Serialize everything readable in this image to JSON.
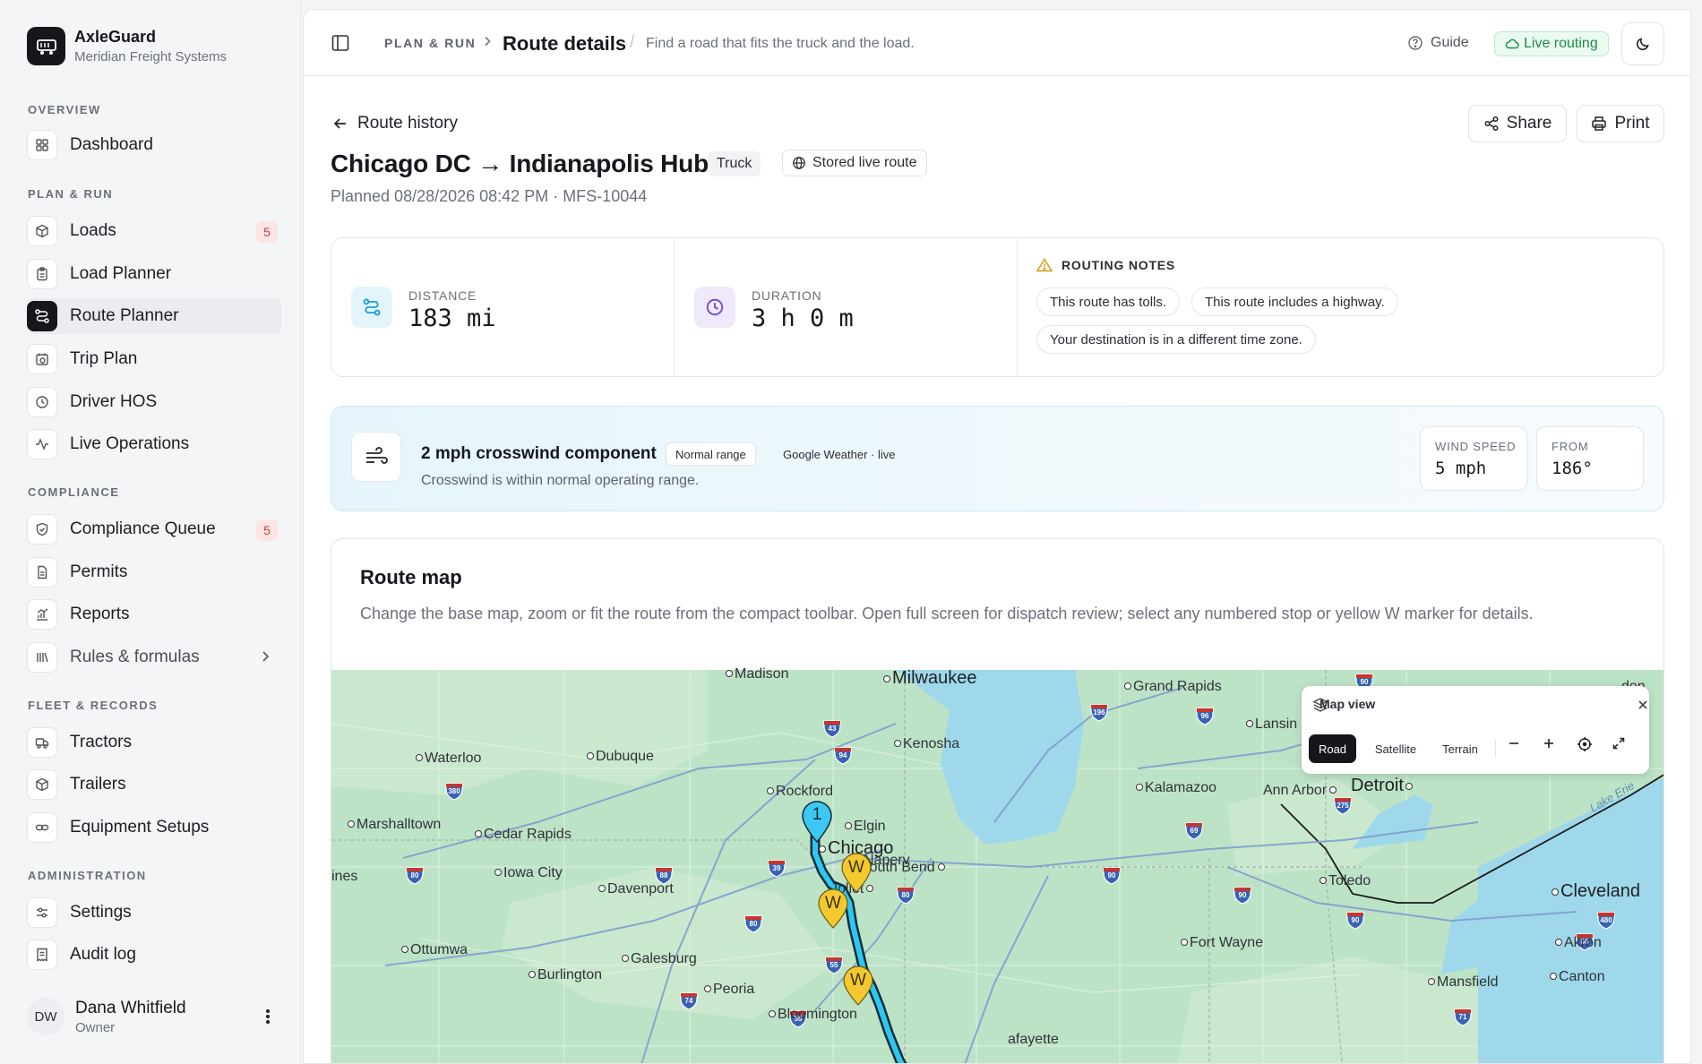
{
  "brand": {
    "name": "AxleGuard",
    "org": "Meridian Freight Systems"
  },
  "nav": {
    "overview_label": "OVERVIEW",
    "plan_label": "PLAN & RUN",
    "compliance_label": "COMPLIANCE",
    "fleet_label": "FLEET & RECORDS",
    "admin_label": "ADMINISTRATION",
    "items": {
      "dashboard": "Dashboard",
      "loads": "Loads",
      "loads_badge": "5",
      "load_planner": "Load Planner",
      "route_planner": "Route Planner",
      "trip_plan": "Trip Plan",
      "driver_hos": "Driver HOS",
      "live_ops": "Live Operations",
      "compliance_queue": "Compliance Queue",
      "compliance_badge": "5",
      "permits": "Permits",
      "reports": "Reports",
      "rules": "Rules & formulas",
      "tractors": "Tractors",
      "trailers": "Trailers",
      "equipment": "Equipment Setups",
      "settings": "Settings",
      "audit": "Audit log"
    }
  },
  "user": {
    "initials": "DW",
    "name": "Dana Whitfield",
    "role": "Owner"
  },
  "topbar": {
    "section": "PLAN & RUN",
    "title": "Route details",
    "description": "Find a road that fits the truck and the load.",
    "guide": "Guide",
    "live": "Live routing"
  },
  "route": {
    "back": "Route history",
    "share": "Share",
    "print": "Print",
    "title": "Chicago DC → Indianapolis Hub",
    "mode_tag": "Truck",
    "stored_tag": "Stored live route",
    "planned": "Planned 08/28/2026 08:42 PM · MFS-10044"
  },
  "stats": {
    "distance_label": "DISTANCE",
    "distance_value": "183 mi",
    "duration_label": "DURATION",
    "duration_value": "3 h 0 m",
    "notes_label": "ROUTING NOTES",
    "notes": [
      "This route has tolls.",
      "This route includes a highway.",
      "Your destination is in a different time zone."
    ]
  },
  "wind": {
    "title": "2 mph crosswind component",
    "range": "Normal range",
    "source": "Google Weather · live",
    "subtitle": "Crosswind is within normal operating range.",
    "speed_label": "WIND SPEED",
    "speed_value": "5 mph",
    "from_label": "FROM",
    "from_value": "186°"
  },
  "map": {
    "title": "Route map",
    "description": "Change the base map, zoom or fit the route from the compact toolbar. Open full screen for dispatch review; select any numbered stop or yellow W marker for details.",
    "view_title": "Map view",
    "road": "Road",
    "satellite": "Satellite",
    "terrain": "Terrain",
    "stop_number": "1",
    "waypoint_label": "W",
    "lake_label": "Lake Erie",
    "cities": {
      "madison": "Madison",
      "milwaukee": "Milwaukee",
      "grand_rapids": "Grand Rapids",
      "lansing": "Lansin",
      "kenosha": "Kenosha",
      "waterloo": "Waterloo",
      "dubuque": "Dubuque",
      "rockford": "Rockford",
      "kalamazoo": "Kalamazoo",
      "ann_arbor": "Ann Arbor",
      "detroit": "Detroit",
      "marshalltown": "Marshalltown",
      "cedar_rapids": "Cedar Rapids",
      "elgin": "Elgin",
      "chicago": "Chicago",
      "naperville": "Naperv",
      "south_bend": "South Bend",
      "toledo": "Toledo",
      "iowa_city": "Iowa City",
      "davenport": "Davenport",
      "joliet": "Joliet",
      "cleveland": "Cleveland",
      "ines": "ines",
      "fort_wayne": "Fort Wayne",
      "akron": "Akron",
      "ottumwa": "Ottumwa",
      "galesburg": "Galesburg",
      "burlington": "Burlington",
      "peoria": "Peoria",
      "mansfield": "Mansfield",
      "canton": "Canton",
      "bloomington": "Bloomington",
      "lafayette": "afayette",
      "london": "don"
    },
    "shields": [
      "90",
      "196",
      "96",
      "43",
      "94",
      "380",
      "275",
      "69",
      "80",
      "88",
      "39",
      "80",
      "90",
      "90",
      "90",
      "480",
      "80",
      "80",
      "55",
      "74",
      "55",
      "71"
    ]
  },
  "colors": {
    "route": "#2fc6f0",
    "waypoint": "#f4c930",
    "stop": "#3cc8f2",
    "water": "#9fd8ea",
    "land": "#bde3c6",
    "live": "#1f8a48"
  }
}
